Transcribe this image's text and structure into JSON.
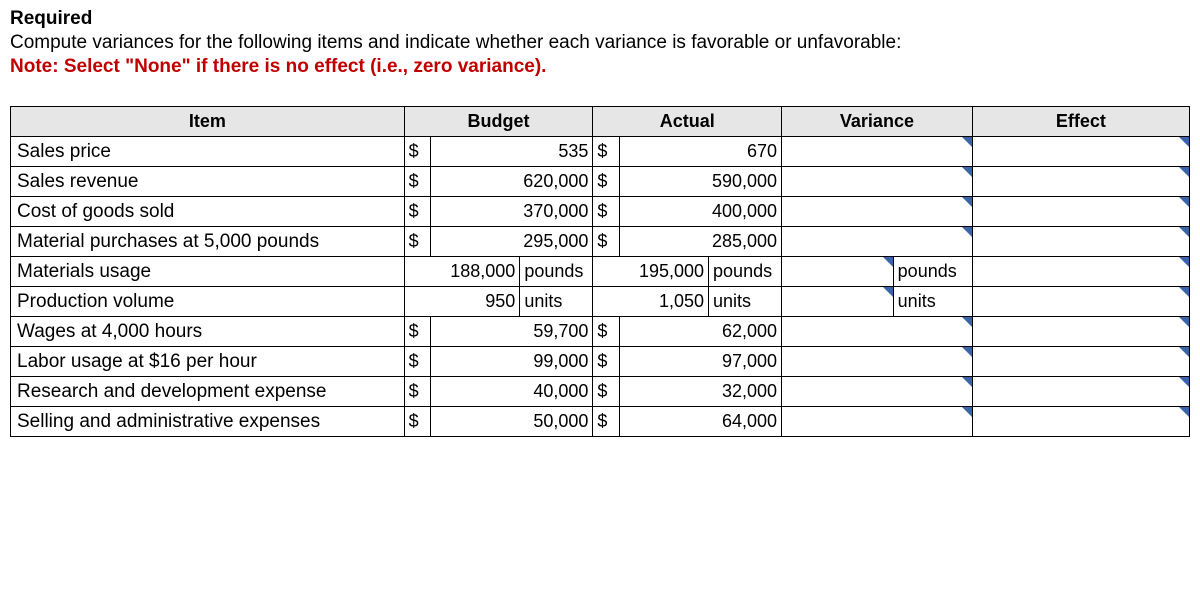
{
  "heading": "Required",
  "instruction": "Compute variances for the following items and indicate whether each variance is favorable or unfavorable:",
  "note": "Note: Select \"None\" if there is no effect (i.e., zero variance).",
  "headers": {
    "item": "Item",
    "budget": "Budget",
    "actual": "Actual",
    "variance": "Variance",
    "effect": "Effect"
  },
  "rows": [
    {
      "item": "Sales price",
      "b_sym": "$",
      "b_val": "535",
      "b_unit": "",
      "a_sym": "$",
      "a_val": "670",
      "a_unit": "",
      "v_unit": ""
    },
    {
      "item": "Sales revenue",
      "b_sym": "$",
      "b_val": "620,000",
      "b_unit": "",
      "a_sym": "$",
      "a_val": "590,000",
      "a_unit": "",
      "v_unit": ""
    },
    {
      "item": "Cost of goods sold",
      "b_sym": "$",
      "b_val": "370,000",
      "b_unit": "",
      "a_sym": "$",
      "a_val": "400,000",
      "a_unit": "",
      "v_unit": ""
    },
    {
      "item": "Material purchases at 5,000 pounds",
      "b_sym": "$",
      "b_val": "295,000",
      "b_unit": "",
      "a_sym": "$",
      "a_val": "285,000",
      "a_unit": "",
      "v_unit": ""
    },
    {
      "item": "Materials usage",
      "b_sym": "",
      "b_val": "188,000",
      "b_unit": "pounds",
      "a_sym": "",
      "a_val": "195,000",
      "a_unit": "pounds",
      "v_unit": "pounds"
    },
    {
      "item": "Production volume",
      "b_sym": "",
      "b_val": "950",
      "b_unit": "units",
      "a_sym": "",
      "a_val": "1,050",
      "a_unit": "units",
      "v_unit": "units"
    },
    {
      "item": "Wages at 4,000 hours",
      "b_sym": "$",
      "b_val": "59,700",
      "b_unit": "",
      "a_sym": "$",
      "a_val": "62,000",
      "a_unit": "",
      "v_unit": ""
    },
    {
      "item": "Labor usage at $16 per hour",
      "b_sym": "$",
      "b_val": "99,000",
      "b_unit": "",
      "a_sym": "$",
      "a_val": "97,000",
      "a_unit": "",
      "v_unit": ""
    },
    {
      "item": "Research and development expense",
      "b_sym": "$",
      "b_val": "40,000",
      "b_unit": "",
      "a_sym": "$",
      "a_val": "32,000",
      "a_unit": "",
      "v_unit": ""
    },
    {
      "item": "Selling and administrative expenses",
      "b_sym": "$",
      "b_val": "50,000",
      "b_unit": "",
      "a_sym": "$",
      "a_val": "64,000",
      "a_unit": "",
      "v_unit": ""
    }
  ]
}
